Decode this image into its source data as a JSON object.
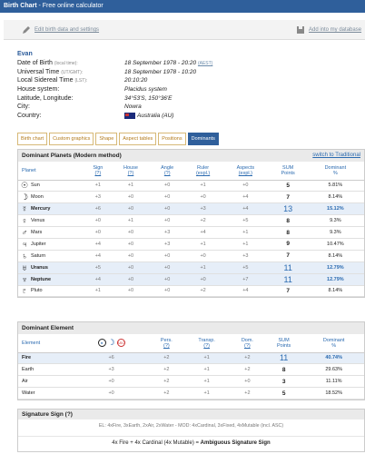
{
  "app": {
    "title": "Birth Chart",
    "subtitle": " - Free online calculator"
  },
  "toolbar": {
    "edit_label": "Edit birth data and settings",
    "add_label": "Add into my database"
  },
  "person": {
    "name": "Evan"
  },
  "info": [
    {
      "label": "Date of Birth",
      "note": "(local time):",
      "value": "18 September 1978 - 20:20",
      "extra": "(AEST)"
    },
    {
      "label": "Universal Time",
      "note": "(UT/GMT):",
      "value": "18 September 1978 - 10:20",
      "extra": ""
    },
    {
      "label": "Local Sidereal Time",
      "note": "(LST):",
      "value": "20:10:20",
      "extra": ""
    },
    {
      "label": "House system:",
      "note": "",
      "value": "Placidus system",
      "extra": ""
    },
    {
      "label": "Latitude, Longitude:",
      "note": "",
      "value": "34°53'S, 150°36'E",
      "extra": ""
    },
    {
      "label": "City:",
      "note": "",
      "value": "Nowra",
      "extra": ""
    },
    {
      "label": "Country:",
      "note": "",
      "value": "Australia (AU)",
      "extra": ""
    }
  ],
  "tabs": [
    "Birth chart",
    "Custom graphics",
    "Shape",
    "Aspect tables",
    "Positions",
    "Dominants"
  ],
  "dominant_planets": {
    "title": "Dominant Planets (Modern method)",
    "switch_label": "switch to Traditional",
    "headers": {
      "planet": "Planet",
      "sign": "Sign",
      "house": "House",
      "angle": "Angle",
      "ruler": "Ruler",
      "aspects": "Aspects",
      "sum": "SUM",
      "sum2": "Points",
      "dominant": "Dominant",
      "pct": "%",
      "q": "(?)",
      "expl": "(expl.)"
    },
    "rows": [
      {
        "symbol": "☉",
        "name": "Sun",
        "sign": "+1",
        "house": "+1",
        "angle": "+0",
        "ruler": "+1",
        "aspects": "+0",
        "sum": "5",
        "pct": "5.81%",
        "hl": false
      },
      {
        "symbol": "☽",
        "name": "Moon",
        "sign": "+3",
        "house": "+0",
        "angle": "+0",
        "ruler": "+0",
        "aspects": "+4",
        "sum": "7",
        "pct": "8.14%",
        "hl": false
      },
      {
        "symbol": "☿",
        "name": "Mercury",
        "sign": "+6",
        "house": "+0",
        "angle": "+0",
        "ruler": "+3",
        "aspects": "+4",
        "sum": "13",
        "pct": "15.12%",
        "hl": true
      },
      {
        "symbol": "♀",
        "name": "Venus",
        "sign": "+0",
        "house": "+1",
        "angle": "+0",
        "ruler": "+2",
        "aspects": "+5",
        "sum": "8",
        "pct": "9.3%",
        "hl": false
      },
      {
        "symbol": "♂",
        "name": "Mars",
        "sign": "+0",
        "house": "+0",
        "angle": "+3",
        "ruler": "+4",
        "aspects": "+1",
        "sum": "8",
        "pct": "9.3%",
        "hl": false
      },
      {
        "symbol": "♃",
        "name": "Jupiter",
        "sign": "+4",
        "house": "+0",
        "angle": "+3",
        "ruler": "+1",
        "aspects": "+1",
        "sum": "9",
        "pct": "10.47%",
        "hl": false
      },
      {
        "symbol": "♄",
        "name": "Saturn",
        "sign": "+4",
        "house": "+0",
        "angle": "+0",
        "ruler": "+0",
        "aspects": "+3",
        "sum": "7",
        "pct": "8.14%",
        "hl": false
      },
      {
        "symbol": "♅",
        "name": "Uranus",
        "sign": "+5",
        "house": "+0",
        "angle": "+0",
        "ruler": "+1",
        "aspects": "+5",
        "sum": "11",
        "pct": "12.79%",
        "hl": true
      },
      {
        "symbol": "♆",
        "name": "Neptune",
        "sign": "+4",
        "house": "+0",
        "angle": "+0",
        "ruler": "+0",
        "aspects": "+7",
        "sum": "11",
        "pct": "12.79%",
        "hl": true
      },
      {
        "symbol": "♇",
        "name": "Pluto",
        "sign": "+1",
        "house": "+0",
        "angle": "+0",
        "ruler": "+2",
        "aspects": "+4",
        "sum": "7",
        "pct": "8.14%",
        "hl": false
      }
    ]
  },
  "dominant_element": {
    "title": "Dominant Element",
    "headers": {
      "element": "Element",
      "pers": "Pers.",
      "transp": "Transp.",
      "dom": "Dom.",
      "sum": "SUM",
      "sum2": "Points",
      "dominant": "Dominant",
      "pct": "%",
      "q": "(?)",
      "asc": "ASC"
    },
    "rows": [
      {
        "name": "Fire",
        "ssm": "+6",
        "pers": "+2",
        "transp": "+1",
        "dom": "+2",
        "sum": "11",
        "pct": "40.74%",
        "hl": true
      },
      {
        "name": "Earth",
        "ssm": "+3",
        "pers": "+2",
        "transp": "+1",
        "dom": "+2",
        "sum": "8",
        "pct": "29.63%",
        "hl": false
      },
      {
        "name": "Air",
        "ssm": "+0",
        "pers": "+2",
        "transp": "+1",
        "dom": "+0",
        "sum": "3",
        "pct": "11.11%",
        "hl": false
      },
      {
        "name": "Water",
        "ssm": "+0",
        "pers": "+2",
        "transp": "+1",
        "dom": "+2",
        "sum": "5",
        "pct": "18.52%",
        "hl": false
      }
    ]
  },
  "signature": {
    "title": "Signature Sign (?)",
    "line1": "EL: 4xFire, 3xEarth, 2xAir, 2xWater - MOD: 4xCardinal, 3xFixed, 4xMutable (incl. ASC)",
    "line2a": "4x Fire + 4x Cardinal (4x Mutable) = ",
    "line2b": "Ambiguous Signature Sign"
  },
  "colors": {
    "header": "#2f5f9b",
    "link": "#2a6ab0",
    "highlight": "#e6eef8"
  }
}
